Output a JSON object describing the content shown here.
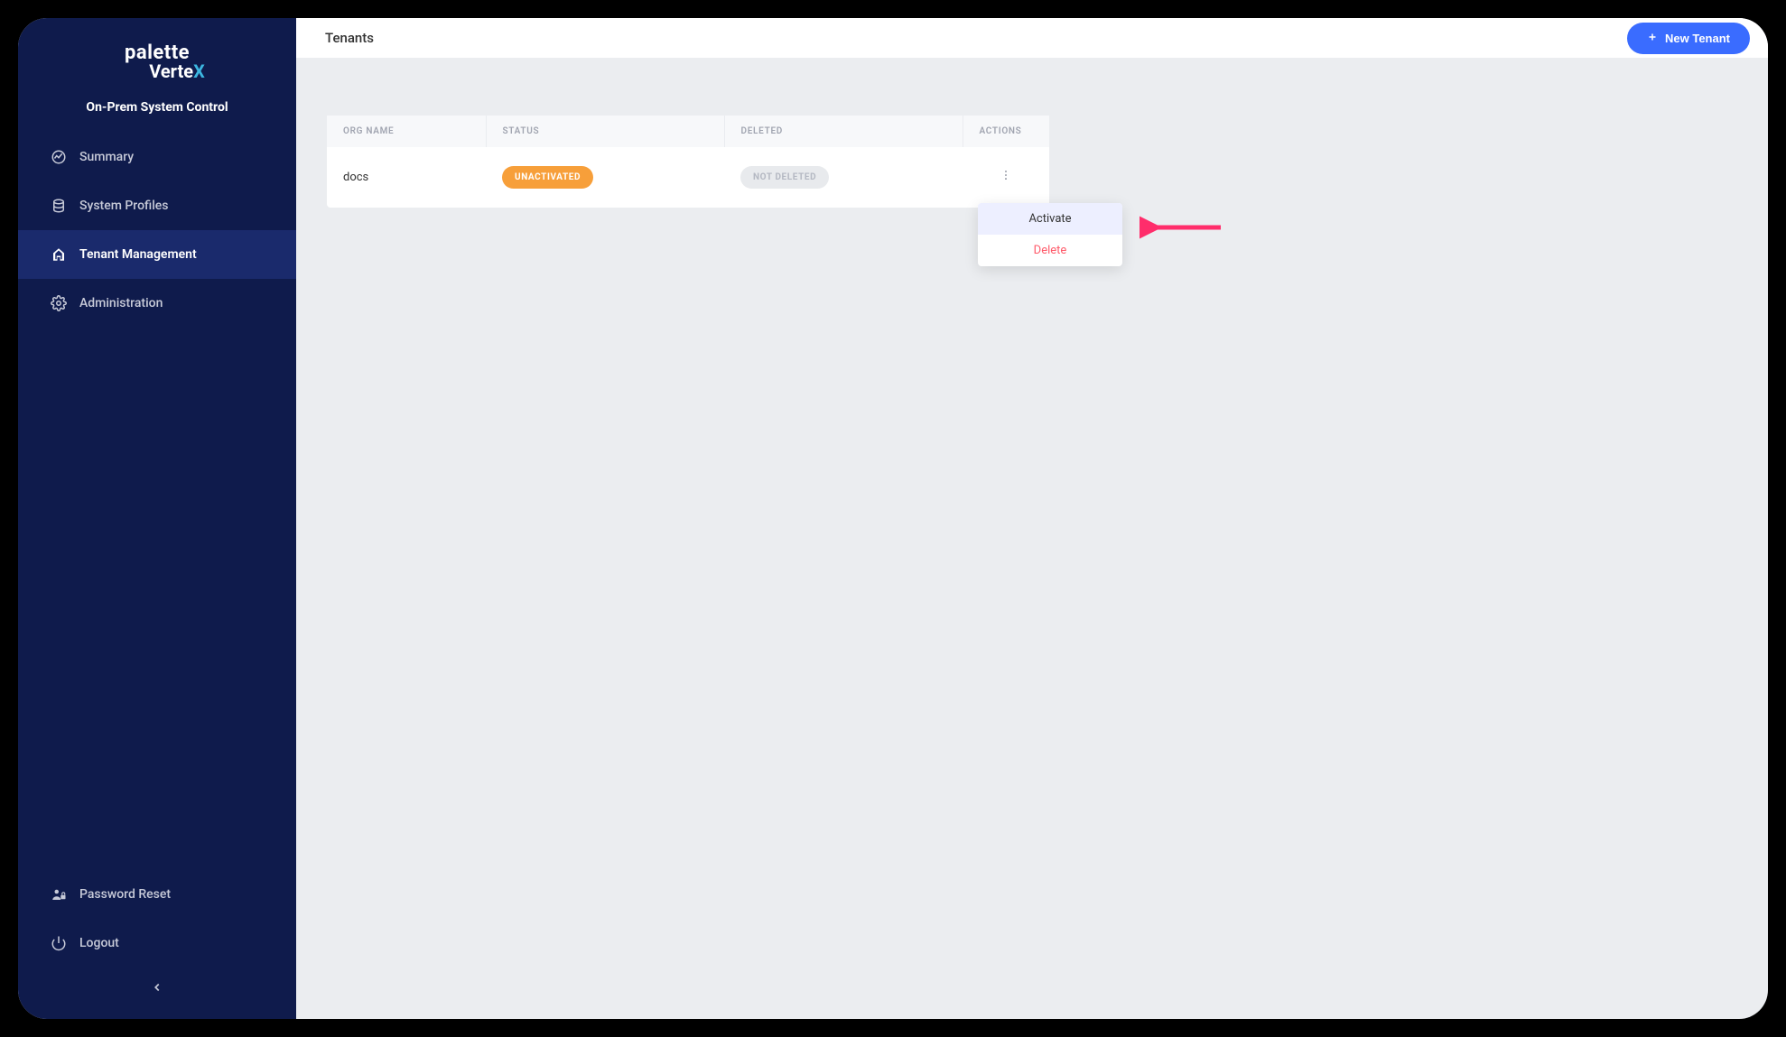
{
  "logo": {
    "main": "palette",
    "sub": "Verte",
    "subAccent": "X"
  },
  "subtitle": "On-Prem System Control",
  "sidebar": {
    "nav": [
      {
        "label": "Summary",
        "icon": "stats-circle"
      },
      {
        "label": "System Profiles",
        "icon": "layers"
      },
      {
        "label": "Tenant Management",
        "icon": "building",
        "active": true
      },
      {
        "label": "Administration",
        "icon": "gear"
      }
    ],
    "bottom": [
      {
        "label": "Password Reset",
        "icon": "lock-person"
      },
      {
        "label": "Logout",
        "icon": "power"
      }
    ]
  },
  "header": {
    "title": "Tenants",
    "newButton": "New Tenant"
  },
  "table": {
    "columns": {
      "orgName": "ORG NAME",
      "status": "STATUS",
      "deleted": "DELETED",
      "actions": "ACTIONS"
    },
    "rows": [
      {
        "orgName": "docs",
        "status": "UNACTIVATED",
        "deleted": "NOT DELETED"
      }
    ]
  },
  "dropdown": {
    "activate": "Activate",
    "delete": "Delete"
  },
  "colors": {
    "sidebarBg": "#0f1b4c",
    "sidebarActive": "#1a2a6c",
    "primaryBlue": "#3a6cff",
    "badgeOrange": "#f79f3a",
    "danger": "#ff5a6a",
    "accent": "#3cb6e0"
  }
}
